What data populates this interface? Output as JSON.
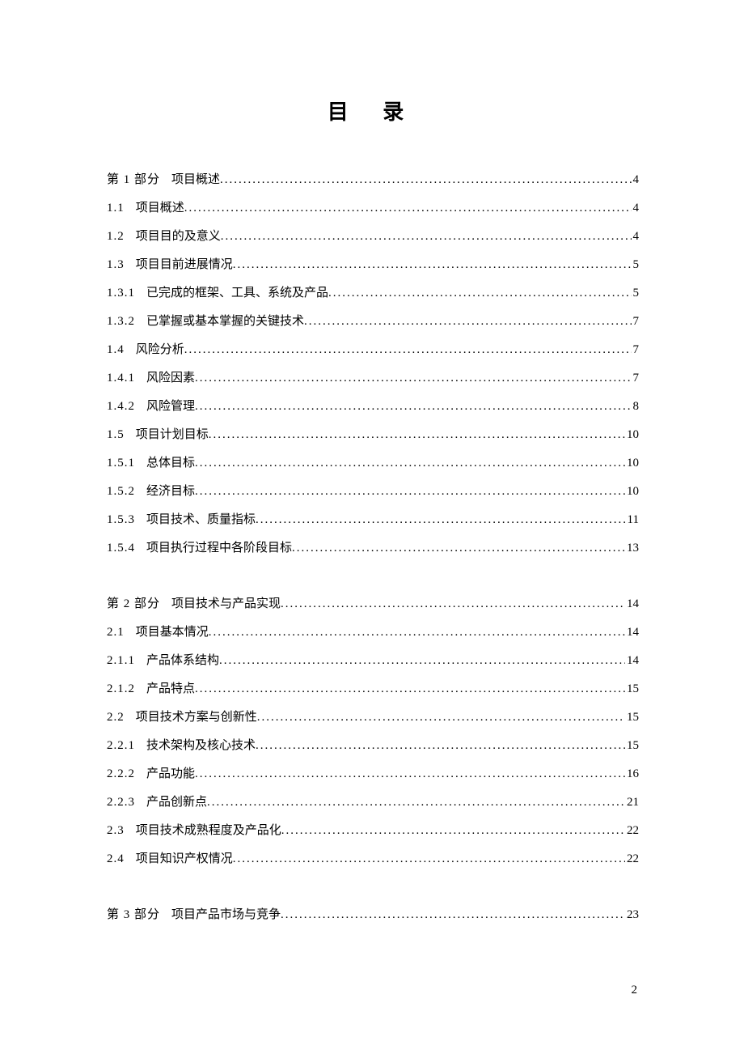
{
  "title": "目 录",
  "page_number": "2",
  "toc": {
    "sections": [
      {
        "entries": [
          {
            "num": "第 1 部分",
            "label": "项目概述",
            "page": "4"
          },
          {
            "num": "1.1",
            "label": "项目概述",
            "page": "4"
          },
          {
            "num": "1.2",
            "label": "项目目的及意义",
            "page": "4"
          },
          {
            "num": "1.3",
            "label": "项目目前进展情况",
            "page": "5"
          },
          {
            "num": "1.3.1",
            "label": "已完成的框架、工具、系统及产品",
            "page": "5"
          },
          {
            "num": "1.3.2",
            "label": "已掌握或基本掌握的关键技术",
            "page": "7"
          },
          {
            "num": "1.4",
            "label": "风险分析",
            "page": "7"
          },
          {
            "num": "1.4.1",
            "label": "风险因素",
            "page": "7"
          },
          {
            "num": "1.4.2",
            "label": "风险管理",
            "page": "8"
          },
          {
            "num": "1.5",
            "label": "项目计划目标",
            "page": "10"
          },
          {
            "num": "1.5.1",
            "label": "总体目标",
            "page": "10"
          },
          {
            "num": "1.5.2",
            "label": "经济目标",
            "page": "10"
          },
          {
            "num": "1.5.3",
            "label": "项目技术、质量指标",
            "page": "11"
          },
          {
            "num": "1.5.4",
            "label": "项目执行过程中各阶段目标",
            "page": "13"
          }
        ]
      },
      {
        "entries": [
          {
            "num": "第 2 部分",
            "label": "项目技术与产品实现",
            "page": "14"
          },
          {
            "num": "2.1",
            "label": "项目基本情况",
            "page": "14"
          },
          {
            "num": "2.1.1",
            "label": "产品体系结构",
            "page": "14"
          },
          {
            "num": "2.1.2",
            "label": "产品特点",
            "page": "15"
          },
          {
            "num": "2.2",
            "label": "项目技术方案与创新性",
            "page": "15"
          },
          {
            "num": "2.2.1",
            "label": "技术架构及核心技术",
            "page": "15"
          },
          {
            "num": "2.2.2",
            "label": "产品功能",
            "page": "16"
          },
          {
            "num": "2.2.3",
            "label": "产品创新点",
            "page": "21"
          },
          {
            "num": "2.3",
            "label": "项目技术成熟程度及产品化",
            "page": "22"
          },
          {
            "num": "2.4",
            "label": "项目知识产权情况",
            "page": "22"
          }
        ]
      },
      {
        "entries": [
          {
            "num": "第 3 部分",
            "label": "项目产品市场与竞争",
            "page": "23"
          }
        ]
      }
    ]
  }
}
